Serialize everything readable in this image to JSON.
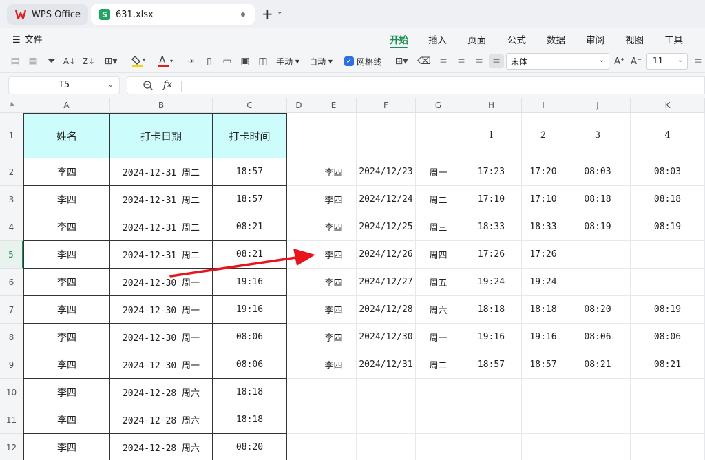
{
  "tabs": {
    "app_label": "WPS Office",
    "file_label": "631.xlsx",
    "new_tab": "+",
    "new_tab_menu": "⌄"
  },
  "menu": {
    "file": "文件",
    "ribbon_tabs": [
      "开始",
      "插入",
      "页面",
      "公式",
      "数据",
      "审阅",
      "视图",
      "工具"
    ],
    "active_tab": "开始"
  },
  "toolbar": {
    "manual_label": "手动",
    "auto_label": "自动",
    "gridlines_label": "网格线",
    "gridlines_checked": true,
    "font_name": "宋体",
    "font_size": "11",
    "accent_color": "#1a8f55",
    "fill_color": "#f5d400",
    "font_color": "#e02020"
  },
  "formula_bar": {
    "cell_ref": "T5",
    "fx_label": "fx",
    "formula": ""
  },
  "sheet": {
    "columns": [
      "A",
      "B",
      "C",
      "D",
      "E",
      "F",
      "G",
      "H",
      "I",
      "J",
      "K"
    ],
    "rows": [
      "1",
      "2",
      "3",
      "4",
      "5",
      "6",
      "7",
      "8",
      "9",
      "10",
      "11",
      "12"
    ],
    "selected_row": "5",
    "left_headers": [
      "姓名",
      "打卡日期",
      "打卡时间"
    ],
    "left_rows": [
      [
        "李四",
        "2024-12-31 周二",
        "18:57"
      ],
      [
        "李四",
        "2024-12-31 周二",
        "18:57"
      ],
      [
        "李四",
        "2024-12-31 周二",
        "08:21"
      ],
      [
        "李四",
        "2024-12-31 周二",
        "08:21"
      ],
      [
        "李四",
        "2024-12-30 周一",
        "19:16"
      ],
      [
        "李四",
        "2024-12-30 周一",
        "19:16"
      ],
      [
        "李四",
        "2024-12-30 周一",
        "08:06"
      ],
      [
        "李四",
        "2024-12-30 周一",
        "08:06"
      ],
      [
        "李四",
        "2024-12-28 周六",
        "18:18"
      ],
      [
        "李四",
        "2024-12-28 周六",
        "18:18"
      ],
      [
        "李四",
        "2024-12-28 周六",
        "08:20"
      ]
    ],
    "right_headers": [
      "",
      "",
      "",
      "1",
      "2",
      "3",
      "4"
    ],
    "right_rows": [
      [
        "李四",
        "2024/12/23",
        "周一",
        "17:23",
        "17:20",
        "08:03",
        "08:03"
      ],
      [
        "李四",
        "2024/12/24",
        "周二",
        "17:10",
        "17:10",
        "08:18",
        "08:18"
      ],
      [
        "李四",
        "2024/12/25",
        "周三",
        "18:33",
        "18:33",
        "08:19",
        "08:19"
      ],
      [
        "李四",
        "2024/12/26",
        "周四",
        "17:26",
        "17:26",
        "",
        ""
      ],
      [
        "李四",
        "2024/12/27",
        "周五",
        "19:24",
        "19:24",
        "",
        ""
      ],
      [
        "李四",
        "2024/12/28",
        "周六",
        "18:18",
        "18:18",
        "08:20",
        "08:19"
      ],
      [
        "李四",
        "2024/12/30",
        "周一",
        "19:16",
        "19:16",
        "08:06",
        "08:06"
      ],
      [
        "李四",
        "2024/12/31",
        "周二",
        "18:57",
        "18:57",
        "08:21",
        "08:21"
      ],
      [
        "",
        "",
        "",
        "",
        "",
        "",
        ""
      ],
      [
        "",
        "",
        "",
        "",
        "",
        "",
        ""
      ],
      [
        "",
        "",
        "",
        "",
        "",
        "",
        ""
      ]
    ],
    "header_fill": "#ccfcfc",
    "arrow_color": "#e8141e"
  }
}
